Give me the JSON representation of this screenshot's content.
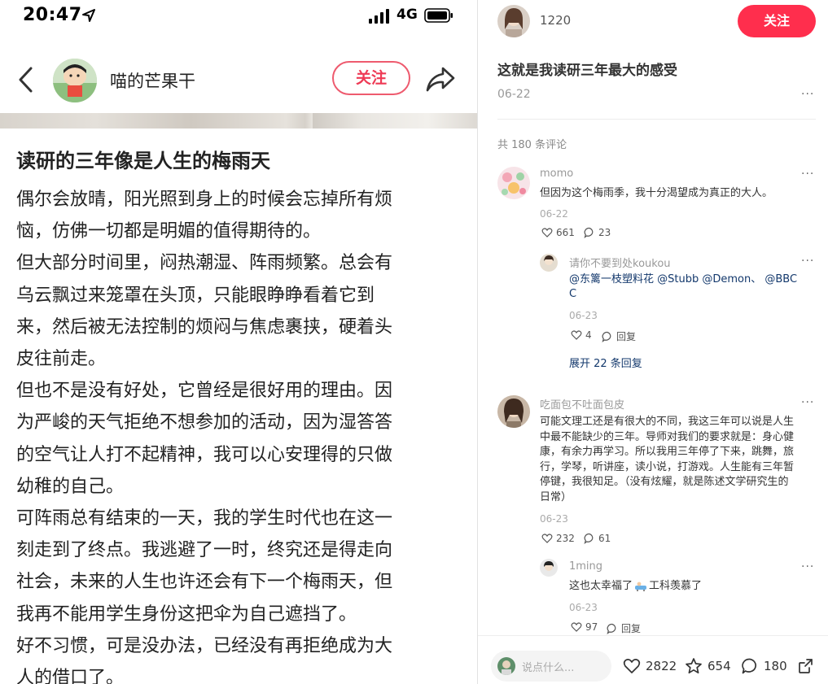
{
  "phone": {
    "status": {
      "time": "20:47",
      "network": "4G"
    },
    "author": "喵的芒果干",
    "follow_label": "关注",
    "post_title": "读研的三年像是人生的梅雨天",
    "body_lines": [
      "偶尔会放晴，阳光照到身上的时候会忘掉所有烦",
      "恼，仿佛一切都是明媚的值得期待的。",
      "但大部分时间里，闷热潮湿、阵雨频繁。总会有",
      "乌云飘过来笼罩在头顶，只能眼睁睁看着它到",
      "来，然后被无法控制的烦闷与焦虑裹挟，硬着头",
      "皮往前走。",
      "但也不是没有好处，它曾经是很好用的理由。因",
      "为严峻的天气拒绝不想参加的活动，因为湿答答",
      "的空气让人打不起精神，我可以心安理得的只做",
      "幼稚的自己。",
      "可阵雨总有结束的一天，我的学生时代也在这一",
      "刻走到了终点。我逃避了一时，终究还是得走向",
      "社会，未来的人生也许还会有下一个梅雨天，但",
      "我再不能用学生身份这把伞为自己遮挡了。",
      "好不习惯，可是没办法，已经没有再拒绝成为大",
      "人的借口了。"
    ]
  },
  "web": {
    "user": "1220",
    "follow_label": "关注",
    "title": "这就是我读研三年最大的感受",
    "date": "06-22",
    "more": "···",
    "comment_count": "共 180 条评论",
    "comments": [
      {
        "name": "momo",
        "text": "但因为这个梅雨季，我十分渴望成为真正的大人。",
        "date": "06-22",
        "likes": "661",
        "replies": "23"
      },
      {
        "name": "请你不要到处koukou",
        "text_line1": "@东篱一枝塑料花 @Stubb @Demon、 @BBC",
        "text_line2": "C",
        "date": "06-23",
        "likes": "4",
        "reply_label": "回复",
        "expand": "展开 22 条回复"
      },
      {
        "name": "吃面包不吐面包皮",
        "lines": [
          "可能文理工还是有很大的不同，我这三年可以说是人生",
          "中最不能缺少的三年。导师对我们的要求就是：身心健",
          "康，有余力再学习。所以我用三年停了下来，跳舞，旅",
          "行，学琴，听讲座，读小说，打游戏。人生能有三年暂",
          "停键，我很知足。（没有炫耀，就是陈述文学研究生的",
          "日常）"
        ],
        "date": "06-23",
        "likes": "232",
        "replies": "61"
      },
      {
        "name": "1ming",
        "text_before": "这也太幸福了",
        "text_after": "工科羡慕了",
        "date": "06-23",
        "likes": "97",
        "reply_label": "回复"
      }
    ],
    "bottom": {
      "placeholder": "说点什么...",
      "likes": "2822",
      "stars": "654",
      "comments": "180"
    }
  }
}
